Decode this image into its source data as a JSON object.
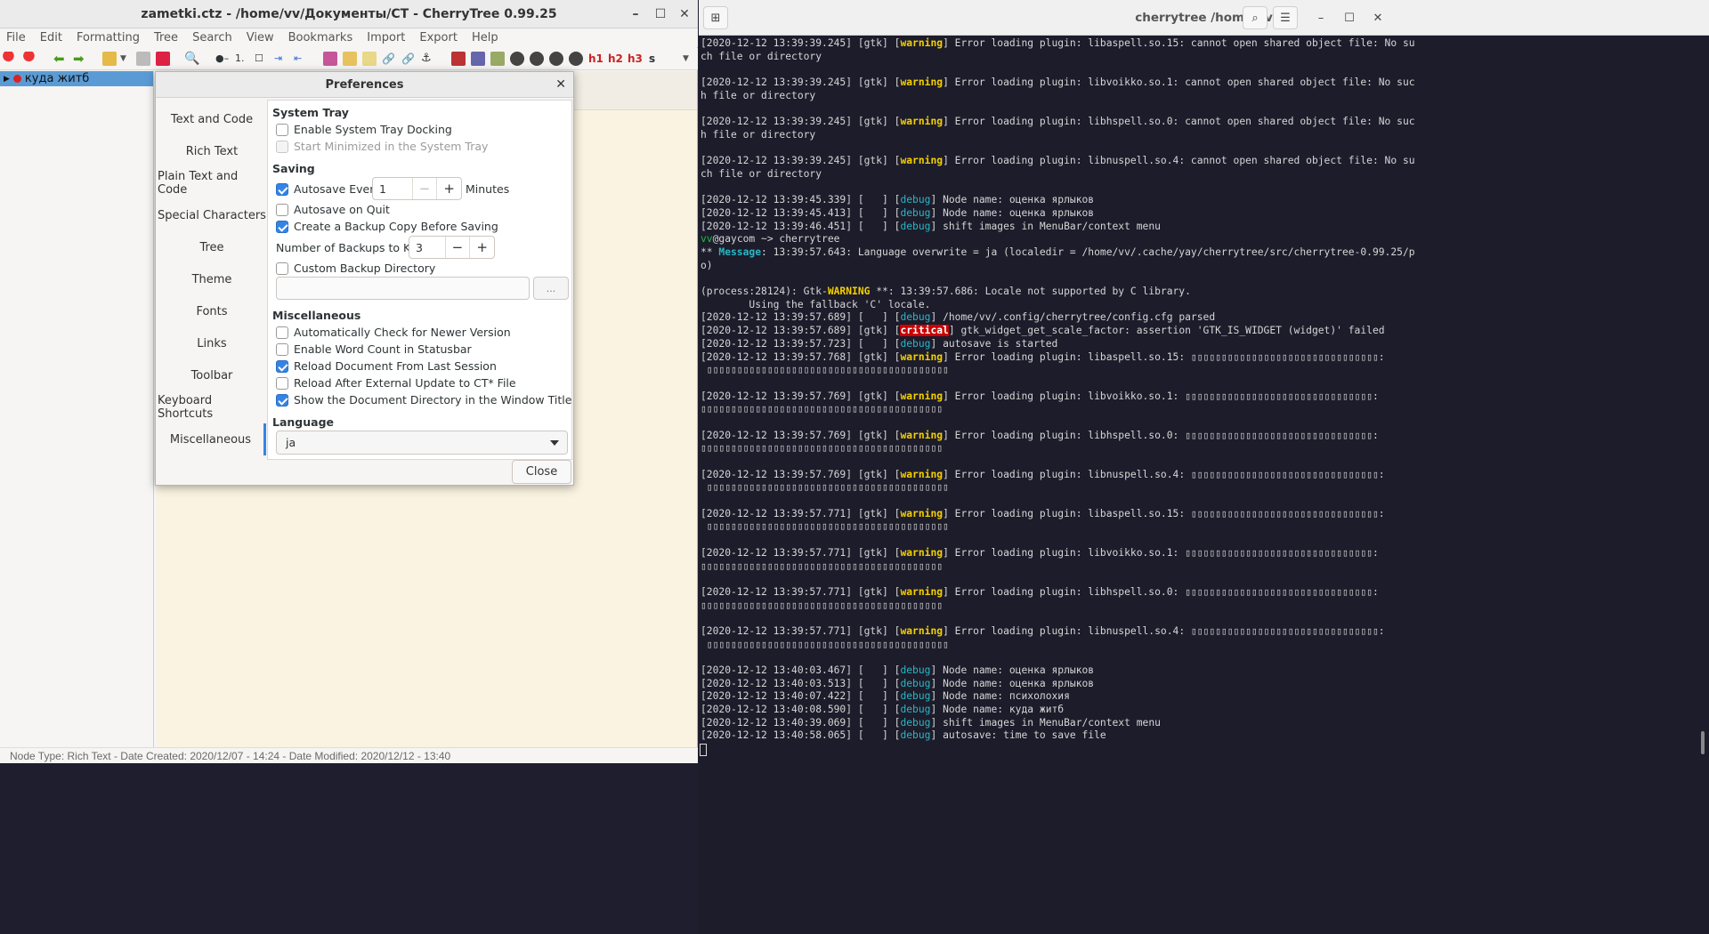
{
  "cherrytree": {
    "title": "zametki.ctz - /home/vv/Документы/CT - CherryTree 0.99.25",
    "menu": [
      "File",
      "Edit",
      "Formatting",
      "Tree",
      "Search",
      "View",
      "Bookmarks",
      "Import",
      "Export",
      "Help"
    ],
    "tree_node": "куда житб",
    "status": "Node Type: Rich Text  -  Date Created: 2020/12/07 - 14:24  -  Date Modified: 2020/12/12 - 13:40"
  },
  "prefs": {
    "title": "Preferences",
    "sidebar": [
      "Text and Code",
      "Rich Text",
      "Plain Text and Code",
      "Special Characters",
      "Tree",
      "Theme",
      "Fonts",
      "Links",
      "Toolbar",
      "Keyboard Shortcuts",
      "Miscellaneous"
    ],
    "selected": "Miscellaneous",
    "system_tray": {
      "heading": "System Tray",
      "enable_docking": "Enable System Tray Docking",
      "start_minimized": "Start Minimized in the System Tray"
    },
    "saving": {
      "heading": "Saving",
      "autosave_every": "Autosave Every",
      "autosave_value": "1",
      "minutes": "Minutes",
      "autosave_on_quit": "Autosave on Quit",
      "backup_copy": "Create a Backup Copy Before Saving",
      "num_backups_label": "Number of Backups to Keep",
      "num_backups_value": "3",
      "custom_dir": "Custom Backup Directory",
      "browse": "..."
    },
    "misc": {
      "heading": "Miscellaneous",
      "check_version": "Automatically Check for Newer Version",
      "word_count": "Enable Word Count in Statusbar",
      "reload_doc": "Reload Document From Last Session",
      "reload_external": "Reload After External Update to CT* File",
      "show_dir": "Show the Document Directory in the Window Title"
    },
    "language": {
      "heading": "Language",
      "value": "ja"
    },
    "close": "Close"
  },
  "terminal": {
    "title": "cherrytree /home/vv",
    "accent_warning": "#f5d000",
    "accent_debug": "#2bb6c4",
    "accent_critical": "#cc0000",
    "lines": [
      {
        "pre": "[2020-12-12 13:39:39.245] [gtk] [",
        "tag": "warning",
        "cls": "w",
        "post": "] Error loading plugin: libaspell.so.15: cannot open shared object file: No su"
      },
      {
        "pre": "ch file or directory"
      },
      {
        "pre": ""
      },
      {
        "pre": "[2020-12-12 13:39:39.245] [gtk] [",
        "tag": "warning",
        "cls": "w",
        "post": "] Error loading plugin: libvoikko.so.1: cannot open shared object file: No suc"
      },
      {
        "pre": "h file or directory"
      },
      {
        "pre": ""
      },
      {
        "pre": "[2020-12-12 13:39:39.245] [gtk] [",
        "tag": "warning",
        "cls": "w",
        "post": "] Error loading plugin: libhspell.so.0: cannot open shared object file: No suc"
      },
      {
        "pre": "h file or directory"
      },
      {
        "pre": ""
      },
      {
        "pre": "[2020-12-12 13:39:39.245] [gtk] [",
        "tag": "warning",
        "cls": "w",
        "post": "] Error loading plugin: libnuspell.so.4: cannot open shared object file: No su"
      },
      {
        "pre": "ch file or directory"
      },
      {
        "pre": ""
      },
      {
        "pre": "[2020-12-12 13:39:45.339] [   ] [",
        "tag": "debug",
        "cls": "d",
        "post": "] Node name: оценка ярлыков"
      },
      {
        "pre": "[2020-12-12 13:39:45.413] [   ] [",
        "tag": "debug",
        "cls": "d",
        "post": "] Node name: оценка ярлыков"
      },
      {
        "pre": "[2020-12-12 13:39:46.451] [   ] [",
        "tag": "debug",
        "cls": "d",
        "post": "] shift images in MenuBar/context menu"
      },
      {
        "pre": "",
        "tag": "vv",
        "cls": "g",
        "post": "@gaycom ~> cherrytree"
      },
      {
        "pre": "** ",
        "tag": "Message",
        "cls": "m",
        "post": ": 13:39:57.643: Language overwrite = ja (localedir = /home/vv/.cache/yay/cherrytree/src/cherrytree-0.99.25/p"
      },
      {
        "pre": "o)"
      },
      {
        "pre": ""
      },
      {
        "pre": "(process:28124): Gtk-",
        "tag": "WARNING",
        "cls": "w",
        "post": " **: 13:39:57.686: Locale not supported by C library."
      },
      {
        "pre": "        Using the fallback 'C' locale."
      },
      {
        "pre": "[2020-12-12 13:39:57.689] [   ] [",
        "tag": "debug",
        "cls": "d",
        "post": "] /home/vv/.config/cherrytree/config.cfg parsed"
      },
      {
        "pre": "[2020-12-12 13:39:57.689] [gtk] [",
        "tag": "critical",
        "cls": "cr",
        "post": "] gtk_widget_get_scale_factor: assertion 'GTK_IS_WIDGET (widget)' failed"
      },
      {
        "pre": "[2020-12-12 13:39:57.723] [   ] [",
        "tag": "debug",
        "cls": "d",
        "post": "] autosave is started"
      },
      {
        "pre": "[2020-12-12 13:39:57.768] [gtk] [",
        "tag": "warning",
        "cls": "w",
        "post": "] Error loading plugin: libaspell.so.15: ▯▯▯▯▯▯▯▯▯▯▯▯▯▯▯▯▯▯▯▯▯▯▯▯▯▯▯▯▯▯▯:"
      },
      {
        "pre": " ▯▯▯▯▯▯▯▯▯▯▯▯▯▯▯▯▯▯▯▯▯▯▯▯▯▯▯▯▯▯▯▯▯▯▯▯▯▯▯▯"
      },
      {
        "pre": ""
      },
      {
        "pre": "[2020-12-12 13:39:57.769] [gtk] [",
        "tag": "warning",
        "cls": "w",
        "post": "] Error loading plugin: libvoikko.so.1: ▯▯▯▯▯▯▯▯▯▯▯▯▯▯▯▯▯▯▯▯▯▯▯▯▯▯▯▯▯▯▯:"
      },
      {
        "pre": "▯▯▯▯▯▯▯▯▯▯▯▯▯▯▯▯▯▯▯▯▯▯▯▯▯▯▯▯▯▯▯▯▯▯▯▯▯▯▯▯"
      },
      {
        "pre": ""
      },
      {
        "pre": "[2020-12-12 13:39:57.769] [gtk] [",
        "tag": "warning",
        "cls": "w",
        "post": "] Error loading plugin: libhspell.so.0: ▯▯▯▯▯▯▯▯▯▯▯▯▯▯▯▯▯▯▯▯▯▯▯▯▯▯▯▯▯▯▯:"
      },
      {
        "pre": "▯▯▯▯▯▯▯▯▯▯▯▯▯▯▯▯▯▯▯▯▯▯▯▯▯▯▯▯▯▯▯▯▯▯▯▯▯▯▯▯"
      },
      {
        "pre": ""
      },
      {
        "pre": "[2020-12-12 13:39:57.769] [gtk] [",
        "tag": "warning",
        "cls": "w",
        "post": "] Error loading plugin: libnuspell.so.4: ▯▯▯▯▯▯▯▯▯▯▯▯▯▯▯▯▯▯▯▯▯▯▯▯▯▯▯▯▯▯▯:"
      },
      {
        "pre": " ▯▯▯▯▯▯▯▯▯▯▯▯▯▯▯▯▯▯▯▯▯▯▯▯▯▯▯▯▯▯▯▯▯▯▯▯▯▯▯▯"
      },
      {
        "pre": ""
      },
      {
        "pre": "[2020-12-12 13:39:57.771] [gtk] [",
        "tag": "warning",
        "cls": "w",
        "post": "] Error loading plugin: libaspell.so.15: ▯▯▯▯▯▯▯▯▯▯▯▯▯▯▯▯▯▯▯▯▯▯▯▯▯▯▯▯▯▯▯:"
      },
      {
        "pre": " ▯▯▯▯▯▯▯▯▯▯▯▯▯▯▯▯▯▯▯▯▯▯▯▯▯▯▯▯▯▯▯▯▯▯▯▯▯▯▯▯"
      },
      {
        "pre": ""
      },
      {
        "pre": "[2020-12-12 13:39:57.771] [gtk] [",
        "tag": "warning",
        "cls": "w",
        "post": "] Error loading plugin: libvoikko.so.1: ▯▯▯▯▯▯▯▯▯▯▯▯▯▯▯▯▯▯▯▯▯▯▯▯▯▯▯▯▯▯▯:"
      },
      {
        "pre": "▯▯▯▯▯▯▯▯▯▯▯▯▯▯▯▯▯▯▯▯▯▯▯▯▯▯▯▯▯▯▯▯▯▯▯▯▯▯▯▯"
      },
      {
        "pre": ""
      },
      {
        "pre": "[2020-12-12 13:39:57.771] [gtk] [",
        "tag": "warning",
        "cls": "w",
        "post": "] Error loading plugin: libhspell.so.0: ▯▯▯▯▯▯▯▯▯▯▯▯▯▯▯▯▯▯▯▯▯▯▯▯▯▯▯▯▯▯▯:"
      },
      {
        "pre": "▯▯▯▯▯▯▯▯▯▯▯▯▯▯▯▯▯▯▯▯▯▯▯▯▯▯▯▯▯▯▯▯▯▯▯▯▯▯▯▯"
      },
      {
        "pre": ""
      },
      {
        "pre": "[2020-12-12 13:39:57.771] [gtk] [",
        "tag": "warning",
        "cls": "w",
        "post": "] Error loading plugin: libnuspell.so.4: ▯▯▯▯▯▯▯▯▯▯▯▯▯▯▯▯▯▯▯▯▯▯▯▯▯▯▯▯▯▯▯:"
      },
      {
        "pre": " ▯▯▯▯▯▯▯▯▯▯▯▯▯▯▯▯▯▯▯▯▯▯▯▯▯▯▯▯▯▯▯▯▯▯▯▯▯▯▯▯"
      },
      {
        "pre": ""
      },
      {
        "pre": "[2020-12-12 13:40:03.467] [   ] [",
        "tag": "debug",
        "cls": "d",
        "post": "] Node name: оценка ярлыков"
      },
      {
        "pre": "[2020-12-12 13:40:03.513] [   ] [",
        "tag": "debug",
        "cls": "d",
        "post": "] Node name: оценка ярлыков"
      },
      {
        "pre": "[2020-12-12 13:40:07.422] [   ] [",
        "tag": "debug",
        "cls": "d",
        "post": "] Node name: психолохия"
      },
      {
        "pre": "[2020-12-12 13:40:08.590] [   ] [",
        "tag": "debug",
        "cls": "d",
        "post": "] Node name: куда житб"
      },
      {
        "pre": "[2020-12-12 13:40:39.069] [   ] [",
        "tag": "debug",
        "cls": "d",
        "post": "] shift images in MenuBar/context menu"
      },
      {
        "pre": "[2020-12-12 13:40:58.065] [   ] [",
        "tag": "debug",
        "cls": "d",
        "post": "] autosave: time to save file"
      }
    ]
  }
}
